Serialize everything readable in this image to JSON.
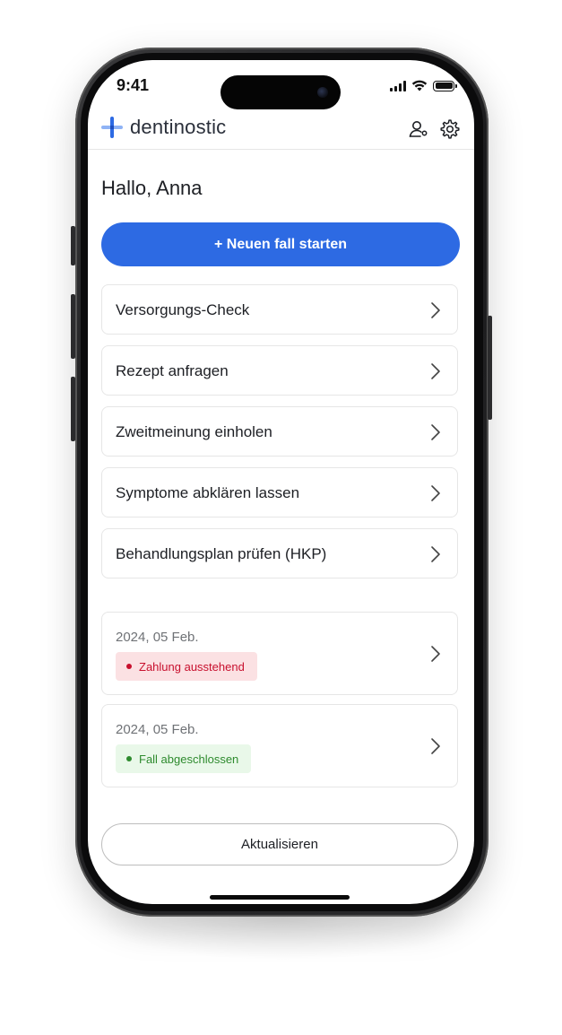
{
  "status_bar": {
    "time": "9:41"
  },
  "header": {
    "brand": "dentinostic",
    "brand_color": "#2d6ae3",
    "icons": [
      "user-add-icon",
      "gear-icon"
    ]
  },
  "greeting": "Hallo, Anna",
  "primary_button": {
    "label": "+ Neuen fall starten",
    "color": "#2d6ae3"
  },
  "menu": [
    {
      "label": "Versorgungs-Check"
    },
    {
      "label": "Rezept anfragen"
    },
    {
      "label": "Zweitmeinung einholen"
    },
    {
      "label": "Symptome abklären lassen"
    },
    {
      "label": "Behandlungsplan prüfen (HKP)"
    }
  ],
  "cases": [
    {
      "date": "2024, 05 Feb.",
      "status": "Zahlung ausstehend",
      "status_color": "#c8102e",
      "status_bg": "#fbe1e3"
    },
    {
      "date": "2024, 05 Feb.",
      "status": "Fall abgeschlossen",
      "status_color": "#2e8b2e",
      "status_bg": "#e9f8e9"
    }
  ],
  "refresh_button": {
    "label": "Aktualisieren"
  }
}
